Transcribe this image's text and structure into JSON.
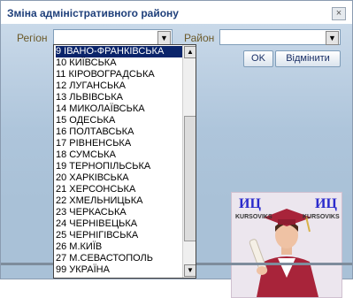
{
  "dialog": {
    "title": "Зміна адміністративного району",
    "close_glyph": "×"
  },
  "filters": {
    "region_label": "Регіон",
    "region_value": "",
    "district_label": "Район",
    "district_value": "",
    "arrow_glyph": "▼"
  },
  "buttons": {
    "ok": "OK",
    "cancel": "Відмінити"
  },
  "dropdown": {
    "options": [
      "9 ІВАНО-ФРАНКІВСЬКА",
      "10 КИЇВСЬКА",
      "11 КІРОВОГРАДСЬКА",
      "12 ЛУГАНСЬКА",
      "13 ЛЬВІВСЬКА",
      "14 МИКОЛАЇВСЬКА",
      "15 ОДЕСЬКА",
      "16 ПОЛТАВСЬКА",
      "17 РІВНЕНСЬКА",
      "18 СУМСЬКА",
      "19 ТЕРНОПІЛЬСЬКА",
      "20 ХАРКІВСЬКА",
      "21 ХЕРСОНСЬКА",
      "22 ХМЕЛЬНИЦЬКА",
      "23 ЧЕРКАСЬКА",
      "24 ЧЕРНІВЕЦЬКА",
      "25 ЧЕРНІГІВСЬКА",
      "26 М.КИЇВ",
      "27 М.СЕВАСТОПОЛЬ",
      "99 УКРАЇНА"
    ],
    "selected_index": 0,
    "scroll_up": "▲",
    "scroll_down": "▼"
  },
  "logo": {
    "left_text": "ИЦ",
    "right_text": "ИЦ",
    "left_sub": "KURSOVIKS",
    "right_sub": "KURSOVIKS"
  },
  "colors": {
    "title": "#1e3f7a",
    "label": "#6b5a2a",
    "selected_bg": "#0a246a",
    "panel": "#aec5db"
  }
}
